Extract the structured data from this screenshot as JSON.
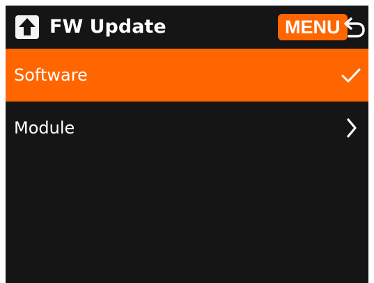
{
  "header": {
    "title": "FW Update",
    "icon": "upload-arrow-icon",
    "menu_label": "MENU",
    "back_icon": "return-arrow-icon"
  },
  "list": {
    "items": [
      {
        "label": "Software",
        "selected": true,
        "indicator": "checkmark-icon"
      },
      {
        "label": "Module",
        "selected": false,
        "indicator": "chevron-right-icon"
      }
    ]
  },
  "colors": {
    "accent": "#ff6600",
    "background": "#151515",
    "text": "#ffffff"
  }
}
